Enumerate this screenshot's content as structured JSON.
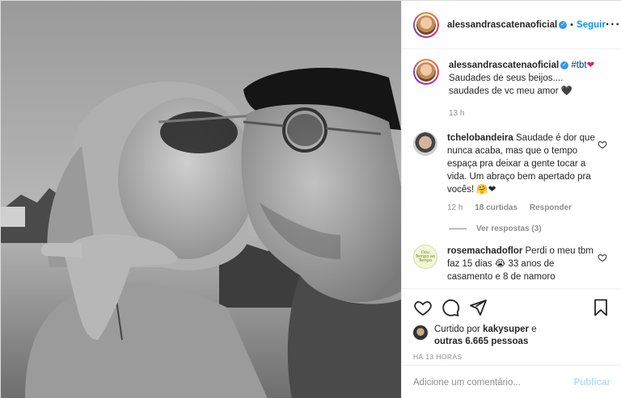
{
  "post": {
    "username": "alessandrascatenaoficial",
    "separator": "•",
    "follow_label": "Seguir",
    "more_label": "···"
  },
  "caption": {
    "username": "alessandrascatenaoficial",
    "hashtag": "#tbt",
    "heart": "❤",
    "text": "Saudades de seus beijos.... saudades de vc meu amor 🖤",
    "time": "13 h"
  },
  "comments": [
    {
      "username": "tchelobandeira",
      "text": "Saudade é dor que nunca acaba, mas que o tempo espaça pra deixar a gente tocar a vida. Um abraço bem apertado pra vocês! 🤗❤",
      "time": "12 h",
      "likes": "18 curtidas",
      "reply_label": "Responder",
      "view_replies": "Ver respostas (3)"
    },
    {
      "username": "rosemachadoflor",
      "text": "Perdi o meu tbm faz 15 dias 😭 33 anos de casamento e 8 de namoro",
      "avatar_text": "Dou Tempo ao Tempo"
    }
  ],
  "likes": {
    "prefix": "Curtido por",
    "user": "kakysuper",
    "connector": "e",
    "others": "outras 6.665 pessoas"
  },
  "timestamp": "HÁ 13 HORAS",
  "comment_box": {
    "placeholder": "Adicione um comentário...",
    "publish_label": "Publicar"
  },
  "icons": {
    "like": "heart-outline-icon",
    "comment": "comment-bubble-icon",
    "share": "paper-plane-icon",
    "save": "bookmark-icon",
    "comment_like": "heart-small-icon"
  },
  "colors": {
    "link_blue": "#0095f6",
    "hashtag": "#00376b",
    "muted": "#8e8e8e",
    "publish_disabled": "#b2dffc",
    "heart_red": "#e0245e"
  }
}
